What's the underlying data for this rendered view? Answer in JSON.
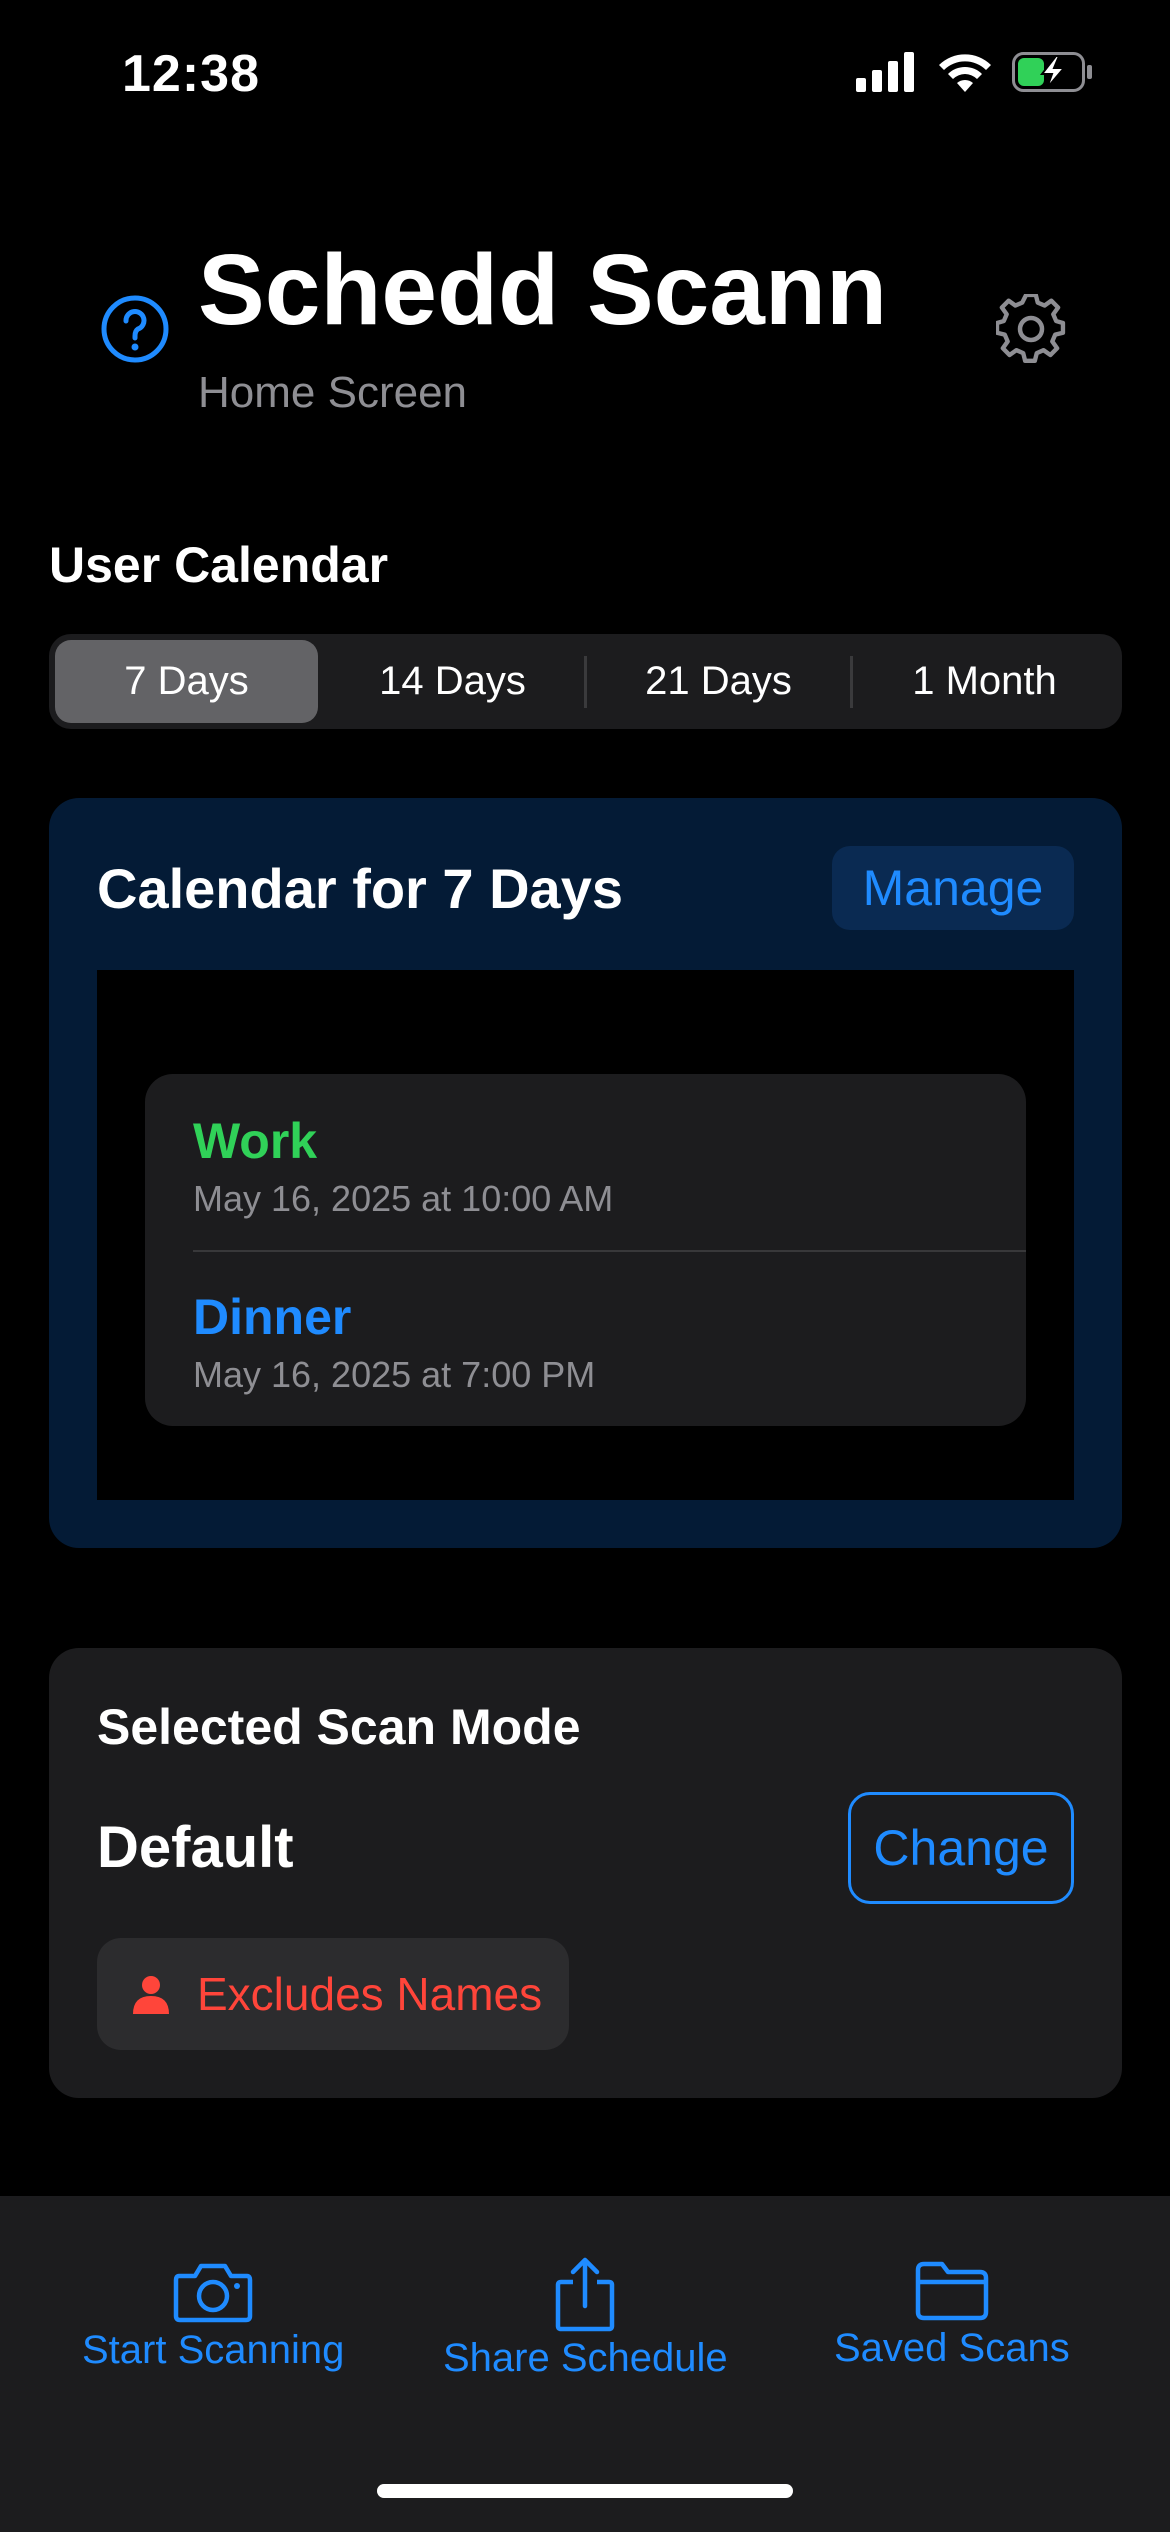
{
  "status_bar": {
    "time": "12:38"
  },
  "header": {
    "title": "Schedd Scann",
    "subtitle": "Home Screen"
  },
  "user_calendar": {
    "label": "User Calendar",
    "ranges": [
      "7 Days",
      "14 Days",
      "21 Days",
      "1 Month"
    ],
    "selected": "7 Days"
  },
  "calendar_card": {
    "title": "Calendar for 7 Days",
    "manage_label": "Manage",
    "events": [
      {
        "title": "Work",
        "date": "May 16, 2025 at 10:00 AM",
        "color": "#30d158"
      },
      {
        "title": "Dinner",
        "date": "May 16, 2025 at 7:00 PM",
        "color": "#1f8bff"
      }
    ]
  },
  "scan_mode": {
    "label": "Selected Scan Mode",
    "mode": "Default",
    "change_label": "Change",
    "badge": "Excludes Names"
  },
  "bottom_bar": {
    "start_label": "Start Scanning",
    "share_label": "Share Schedule",
    "saved_label": "Saved Scans"
  },
  "colors": {
    "accent": "#1f8bff",
    "danger": "#ff453a",
    "success": "#30d158"
  }
}
